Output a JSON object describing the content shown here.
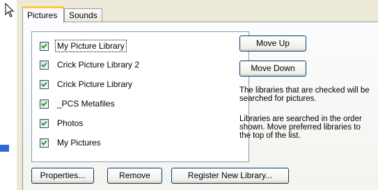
{
  "tabs": [
    {
      "label": "Pictures",
      "active": true
    },
    {
      "label": "Sounds",
      "active": false
    }
  ],
  "libraries": [
    {
      "label": "My Picture Library",
      "checked": true,
      "focused": true
    },
    {
      "label": "Crick Picture Library 2",
      "checked": true,
      "focused": false
    },
    {
      "label": "Crick Picture Library",
      "checked": true,
      "focused": false
    },
    {
      "label": "_PCS Metafiles",
      "checked": true,
      "focused": false
    },
    {
      "label": "Photos",
      "checked": true,
      "focused": false
    },
    {
      "label": "My Pictures",
      "checked": true,
      "focused": false
    }
  ],
  "buttons": {
    "move_up": "Move Up",
    "move_down": "Move Down",
    "properties": "Properties...",
    "remove": "Remove",
    "register_new_library": "Register New Library..."
  },
  "info": {
    "checked_note": "The libraries that are checked will be searched for pictures.",
    "order_note": "Libraries are searched in the order shown. Move preferred libraries to the top of the list."
  },
  "colors": {
    "window_bg": "#ece9d8",
    "active_tab_accent": "#ffc83c",
    "checkmark": "#21a121",
    "button_border": "#003c74"
  },
  "icons": {
    "cursor": "mouse-pointer-icon",
    "check": "checkmark-icon"
  }
}
